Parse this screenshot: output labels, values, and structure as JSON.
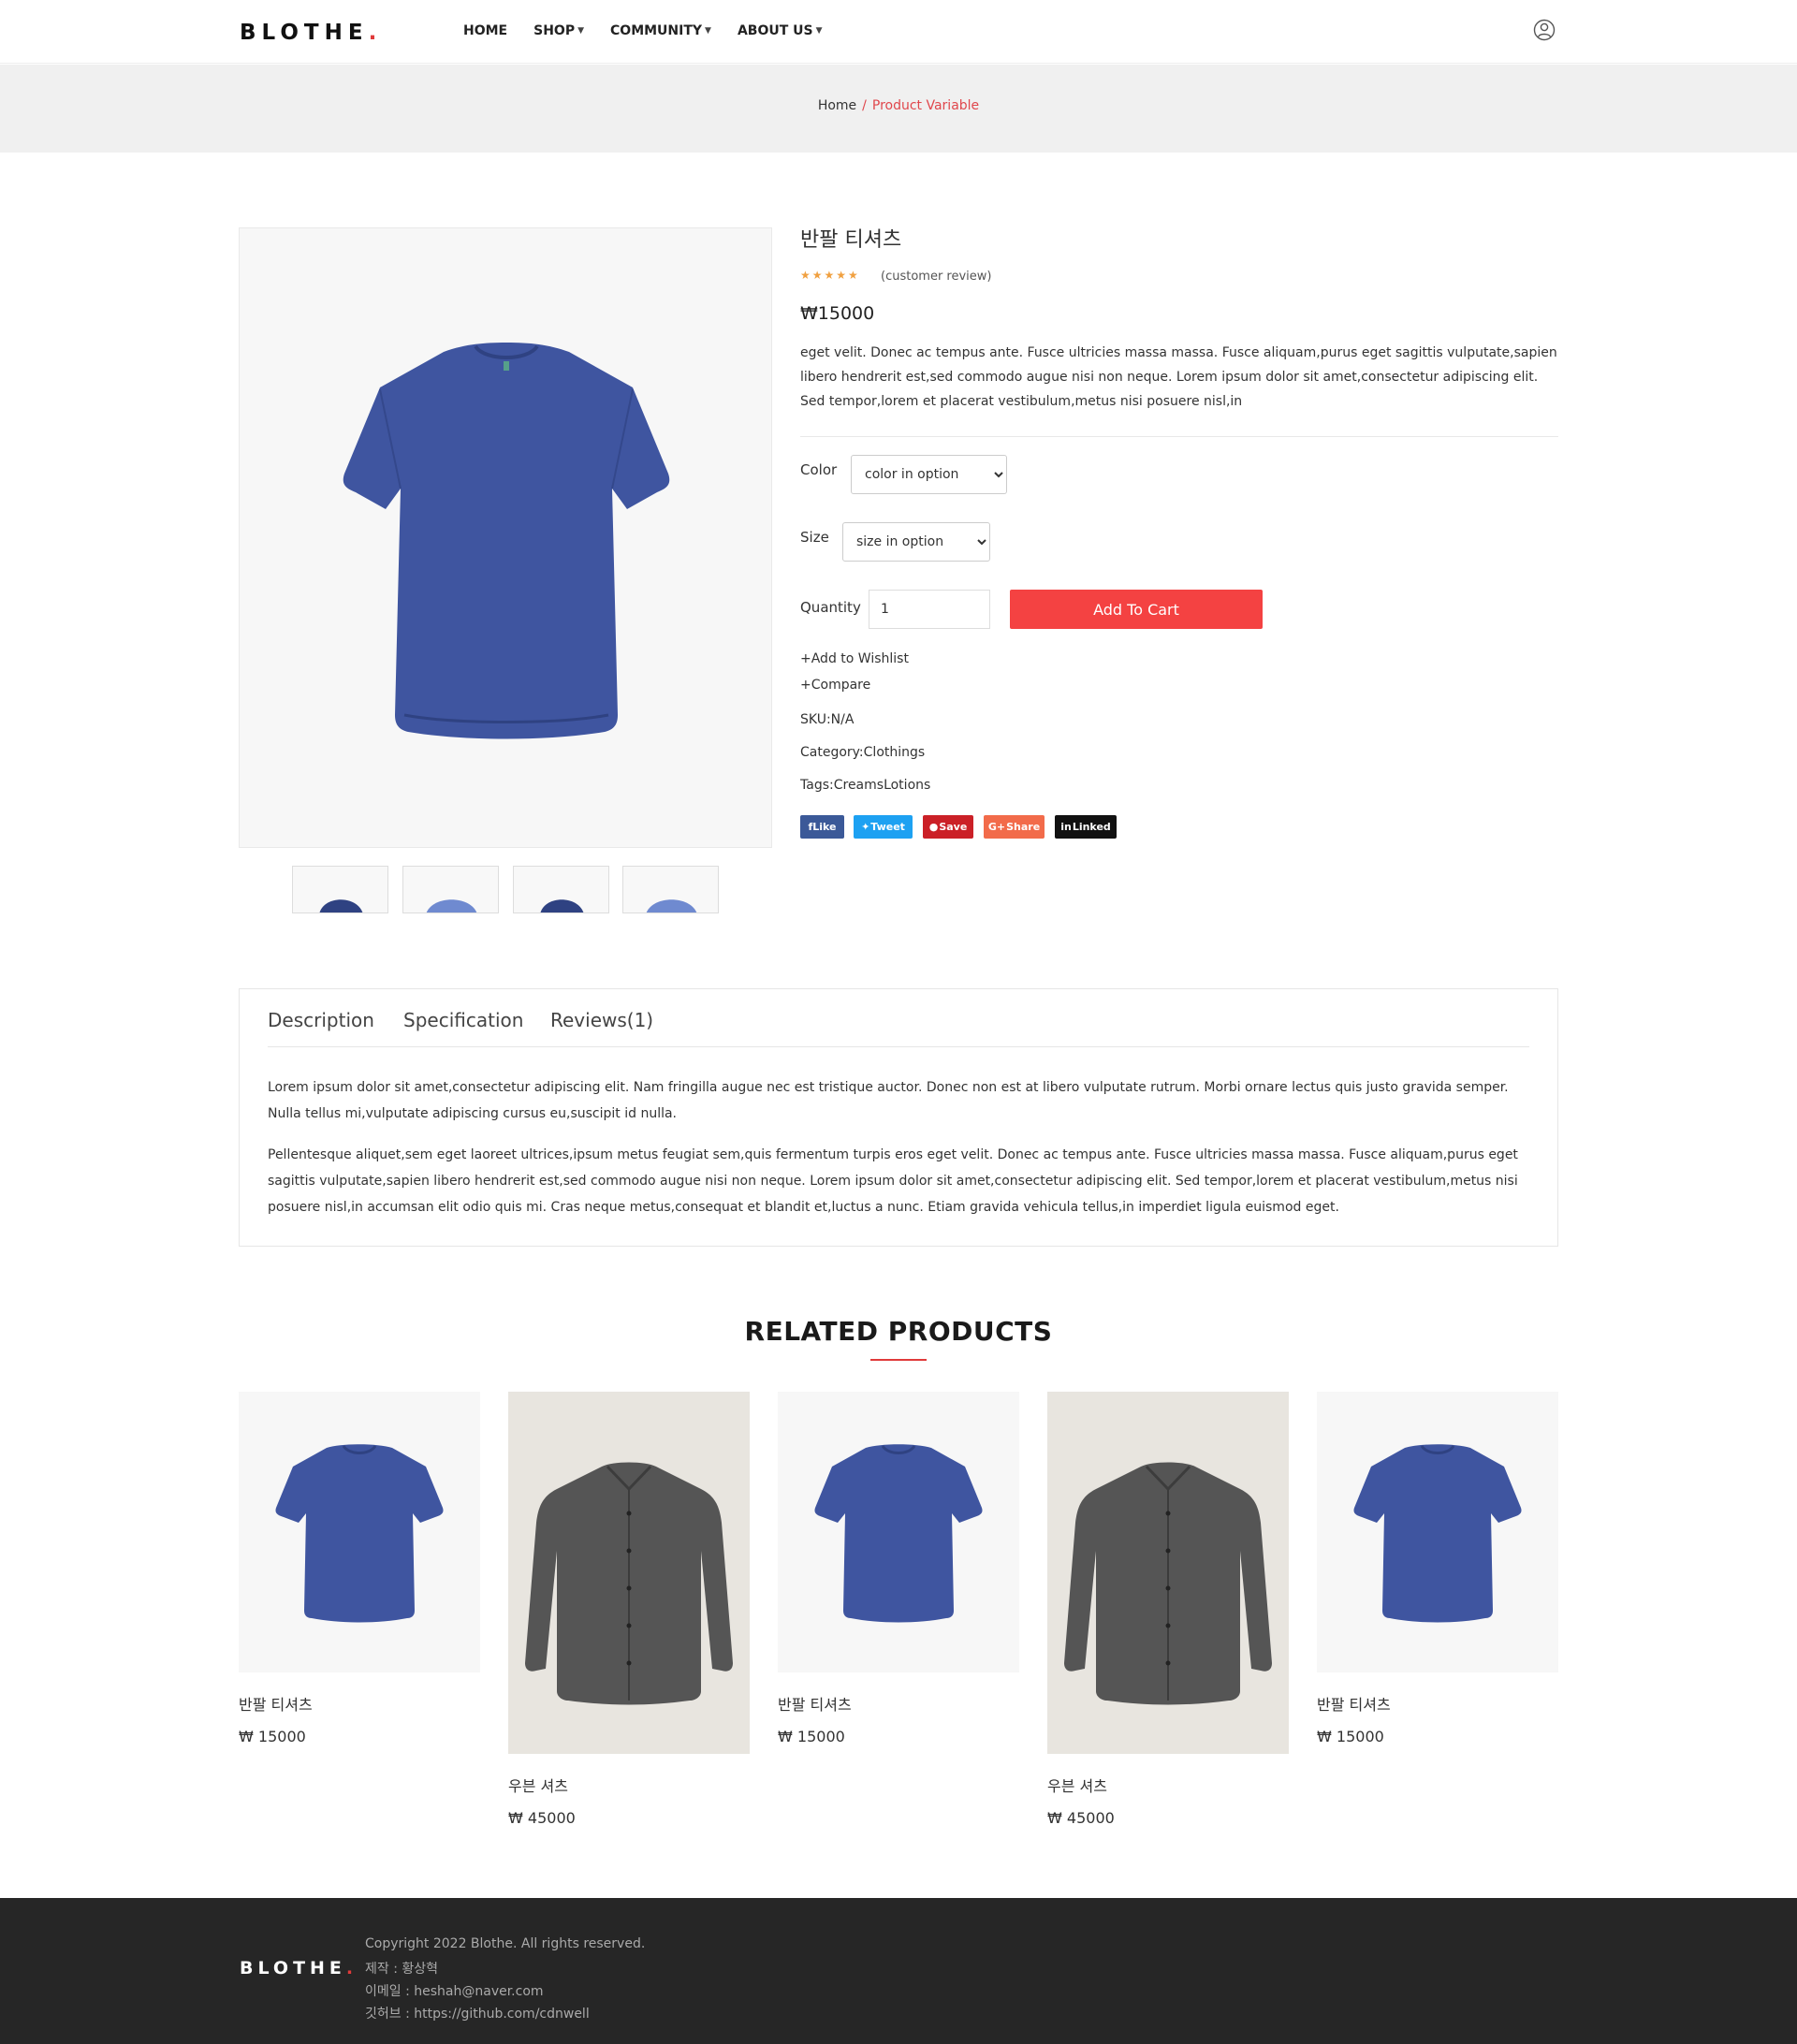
{
  "header": {
    "logo": "BLOTHE",
    "logo_dot": ".",
    "nav": [
      {
        "label": "HOME"
      },
      {
        "label": "SHOP"
      },
      {
        "label": "COMMUNITY"
      },
      {
        "label": "ABOUT US"
      }
    ],
    "user_icon": "user-circle-icon"
  },
  "breadcrumb": {
    "home": "Home",
    "separator": "/",
    "current": "Product Variable"
  },
  "product": {
    "title": "반팔 티셔츠",
    "stars": "★★★★★",
    "rating": 5,
    "review_label": "(customer review)",
    "price": "₩15000",
    "description": "eget velit. Donec ac tempus ante. Fusce ultricies massa massa. Fusce aliquam,purus eget sagittis vulputate,sapien libero hendrerit est,sed commodo augue nisi non neque. Lorem ipsum dolor sit amet,consectetur adipiscing elit. Sed tempor,lorem et placerat vestibulum,metus nisi posuere nisl,in",
    "color_label": "Color",
    "color_selected": "color in option",
    "size_label": "Size",
    "size_selected": "size in option",
    "quantity_label": "Quantity",
    "quantity_value": "1",
    "add_to_cart": "Add To Cart",
    "wishlist": "+Add to Wishlist",
    "compare": "+Compare",
    "sku": "SKU:N/A",
    "category_label": "Category:",
    "category_value": "Clothings",
    "tags_label": "Tags:",
    "tags_value": "CreamsLotions",
    "shares": [
      {
        "label": "fLike",
        "color": "#3b5998"
      },
      {
        "label": "Tweet",
        "color": "#1da1f2"
      },
      {
        "label": "Save",
        "color": "#cb2027"
      },
      {
        "label": "Share",
        "color": "#f26b4a"
      },
      {
        "label": "Linked",
        "color": "#111111"
      }
    ]
  },
  "tabs": {
    "items": [
      {
        "label": "Description"
      },
      {
        "label": "Specification"
      },
      {
        "label": "Reviews(1)"
      }
    ],
    "paragraphs": [
      "Lorem ipsum dolor sit amet,consectetur adipiscing elit. Nam fringilla augue nec est tristique auctor. Donec non est at libero vulputate rutrum. Morbi ornare lectus quis justo gravida semper. Nulla tellus mi,vulputate adipiscing cursus eu,suscipit id nulla.",
      "Pellentesque aliquet,sem eget laoreet ultrices,ipsum metus feugiat sem,quis fermentum turpis eros eget velit. Donec ac tempus ante. Fusce ultricies massa massa. Fusce aliquam,purus eget sagittis vulputate,sapien libero hendrerit est,sed commodo augue nisi non neque. Lorem ipsum dolor sit amet,consectetur adipiscing elit. Sed tempor,lorem et placerat vestibulum,metus nisi posuere nisl,in accumsan elit odio quis mi. Cras neque metus,consequat et blandit et,luctus a nunc. Etiam gravida vehicula tellus,in imperdiet ligula euismod eget."
    ]
  },
  "related": {
    "title": "RELATED PRODUCTS",
    "items": [
      {
        "name": "반팔 티셔츠",
        "price": "₩ 15000"
      },
      {
        "name": "우븐 셔츠",
        "price": "₩ 45000"
      },
      {
        "name": "반팔 티셔츠",
        "price": "₩ 15000"
      },
      {
        "name": "우븐 셔츠",
        "price": "₩ 45000"
      },
      {
        "name": "반팔 티셔츠",
        "price": "₩ 15000"
      }
    ]
  },
  "footer": {
    "logo": "BLOTHE",
    "logo_dot": ".",
    "lines": [
      "Copyright 2022 Blothe. All rights reserved.",
      "제작 : 황상혁",
      "이메일 : heshah@naver.com",
      "깃허브 : https://github.com/cdnwell"
    ]
  },
  "colors": {
    "accent": "#e03a3a",
    "cart_button": "#f44242",
    "tshirt": "#3f55a0",
    "shirt": "#555555",
    "footer_bg": "#262626"
  }
}
